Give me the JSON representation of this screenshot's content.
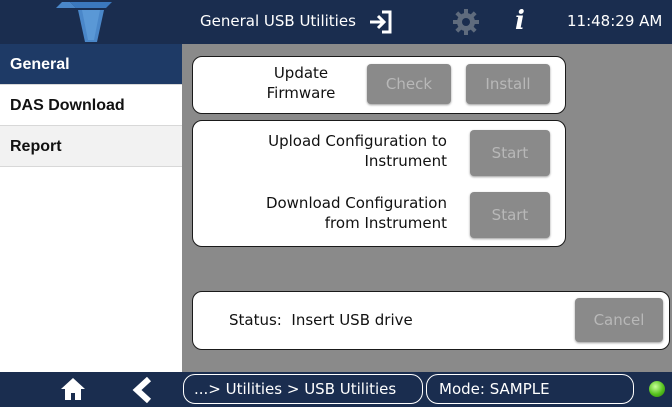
{
  "header": {
    "title": "General USB Utilities",
    "time": "11:48:29 AM",
    "icons": [
      "logo-icon",
      "exit-icon",
      "gear-icon",
      "info-icon"
    ]
  },
  "sidebar": {
    "items": [
      {
        "label": "General",
        "active": true
      },
      {
        "label": "DAS Download",
        "active": false
      },
      {
        "label": "Report",
        "active": false
      }
    ]
  },
  "firmware": {
    "label_line1": "Update",
    "label_line2": "Firmware",
    "check_label": "Check",
    "install_label": "Install"
  },
  "config": {
    "upload_line1": "Upload Configuration to",
    "upload_line2": "Instrument",
    "upload_button": "Start",
    "download_line1": "Download Configuration",
    "download_line2": "from Instrument",
    "download_button": "Start"
  },
  "status": {
    "label": "Status:",
    "value": "Insert USB drive",
    "cancel_label": "Cancel"
  },
  "footer": {
    "breadcrumb": "...> Utilities > USB Utilities",
    "mode": "Mode: SAMPLE",
    "icons": [
      "home-icon",
      "back-icon",
      "status-led-icon"
    ]
  },
  "colors": {
    "bar": "#1a2d4f",
    "active_tab": "#1e3a66",
    "content_bg": "#8a8a8a",
    "disabled_button": "#8a8a8a",
    "status_led": "#55c21d"
  }
}
